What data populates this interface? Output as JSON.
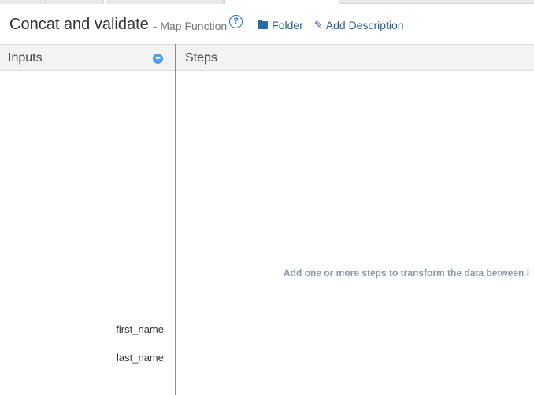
{
  "header": {
    "title": "Concat and validate",
    "subtitle": "- Map Function",
    "help_icon": "help-circle-icon",
    "folder_label": "Folder",
    "folder_icon": "folder-icon",
    "description_label": "Add Description",
    "description_icon": "pencil-icon"
  },
  "inputs_panel": {
    "title": "Inputs",
    "add_icon": "plus-circle-icon",
    "items": [
      "first_name",
      "last_name"
    ]
  },
  "steps_panel": {
    "title": "Steps",
    "empty_message": "Add one or more steps to transform the data between i"
  },
  "colors": {
    "link": "#2a5d9a",
    "accent": "#4d9ee8",
    "header_bg": "#f3f3f3",
    "empty_text": "#8c98a4"
  }
}
